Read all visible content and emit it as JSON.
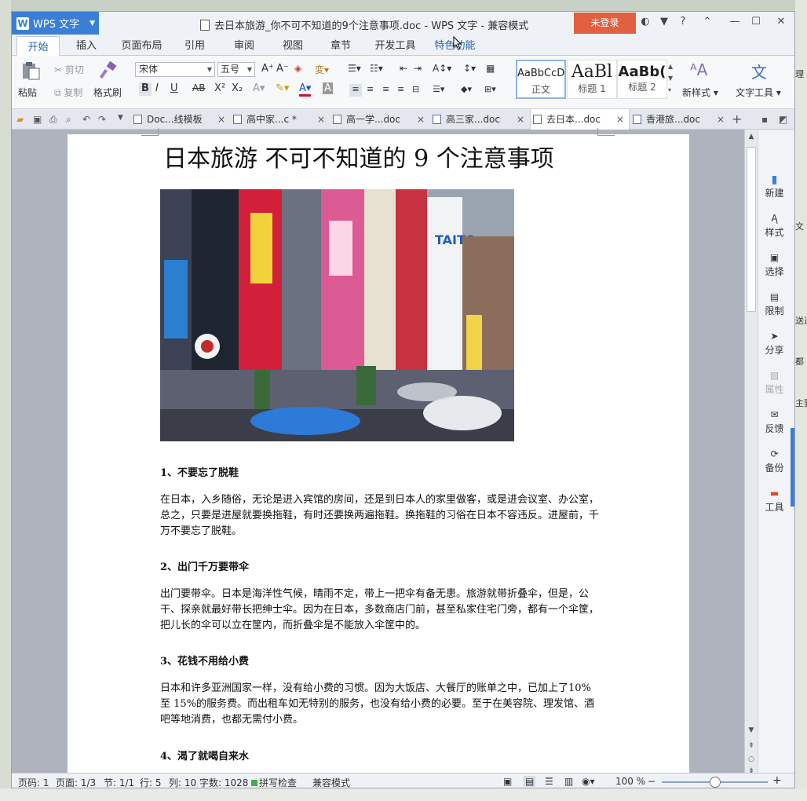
{
  "window": {
    "app_name": "WPS 文字",
    "title": "去日本旅游_你不可不知道的9个注意事项.doc - WPS 文字 - 兼容模式",
    "login": "未登录",
    "help_icon": "?"
  },
  "menu_tabs": [
    "开始",
    "插入",
    "页面布局",
    "引用",
    "审阅",
    "视图",
    "章节",
    "开发工具",
    "特色功能"
  ],
  "ribbon": {
    "paste": "粘贴",
    "cut": "剪切",
    "copy": "复制",
    "format_painter": "格式刷",
    "font_name": "宋体",
    "font_size": "五号",
    "styles": [
      {
        "preview": "AaBbCcD",
        "label": "正文"
      },
      {
        "preview": "AaBl",
        "label": "标题 1"
      },
      {
        "preview": "AaBb(",
        "label": "标题 2"
      }
    ],
    "new_style": "新样式",
    "text_tools": "文字工具",
    "bold": "B",
    "italic": "I",
    "underline": "U",
    "strike": "AB",
    "superscript": "X²",
    "subscript": "X₂"
  },
  "doc_tabs": [
    {
      "label": "Doc...线模板",
      "close": "×"
    },
    {
      "label": "高中家...c *",
      "close": "×"
    },
    {
      "label": "高一学...doc",
      "close": "×"
    },
    {
      "label": "高三家...doc",
      "close": "×"
    },
    {
      "label": "去日本...doc",
      "close": "×"
    },
    {
      "label": "香港旅...doc",
      "close": "×"
    }
  ],
  "document": {
    "title": "日本旅游  不可不知道的 9 个注意事项",
    "sections": [
      {
        "heading": "1、不要忘了脱鞋",
        "body": "在日本，入乡随俗，无论是进入宾馆的房间，还是到日本人的家里做客，或是进会议室、办公室，总之，只要是进屋就要换拖鞋，有时还要换两遍拖鞋。换拖鞋的习俗在日本不容违反。进屋前，千万不要忘了脱鞋。"
      },
      {
        "heading": "2、出门千万要带伞",
        "body": "出门要带伞。日本是海洋性气候，晴雨不定，带上一把伞有备无患。旅游就带折叠伞，但是，公干、探亲就最好带长把绅士伞。因为在日本，多数商店门前，甚至私家住宅门旁，都有一个伞筐，把儿长的伞可以立在筐内，而折叠伞是不能放入伞筐中的。"
      },
      {
        "heading": "3、花钱不用给小费",
        "body": "日本和许多亚洲国家一样，没有给小费的习惯。因为大饭店、大餐厅的账单之中，已加上了10%至 15%的服务费。而出租车如无特别的服务，也没有给小费的必要。至于在美容院、理发馆、酒吧等地消费，也都无需付小费。"
      },
      {
        "heading": "4、渴了就喝自来水",
        "body": ""
      }
    ]
  },
  "sidebar": [
    "新建",
    "样式",
    "选择",
    "限制",
    "分享",
    "属性",
    "反馈",
    "备份",
    "工具"
  ],
  "status": {
    "page_number": "页码: 1",
    "pages": "页面: 1/3",
    "section": "节: 1/1",
    "row": "行: 5",
    "col": "列: 10",
    "word_count": "字数: 1028",
    "spell_check": "拼写检查",
    "mode": "兼容模式",
    "zoom": "100 %"
  },
  "background_right_fragments": [
    "理",
    "文",
    "送迁",
    "都",
    "主要"
  ],
  "colors": {
    "accent": "#3a7fd5",
    "login": "#e0603f"
  }
}
